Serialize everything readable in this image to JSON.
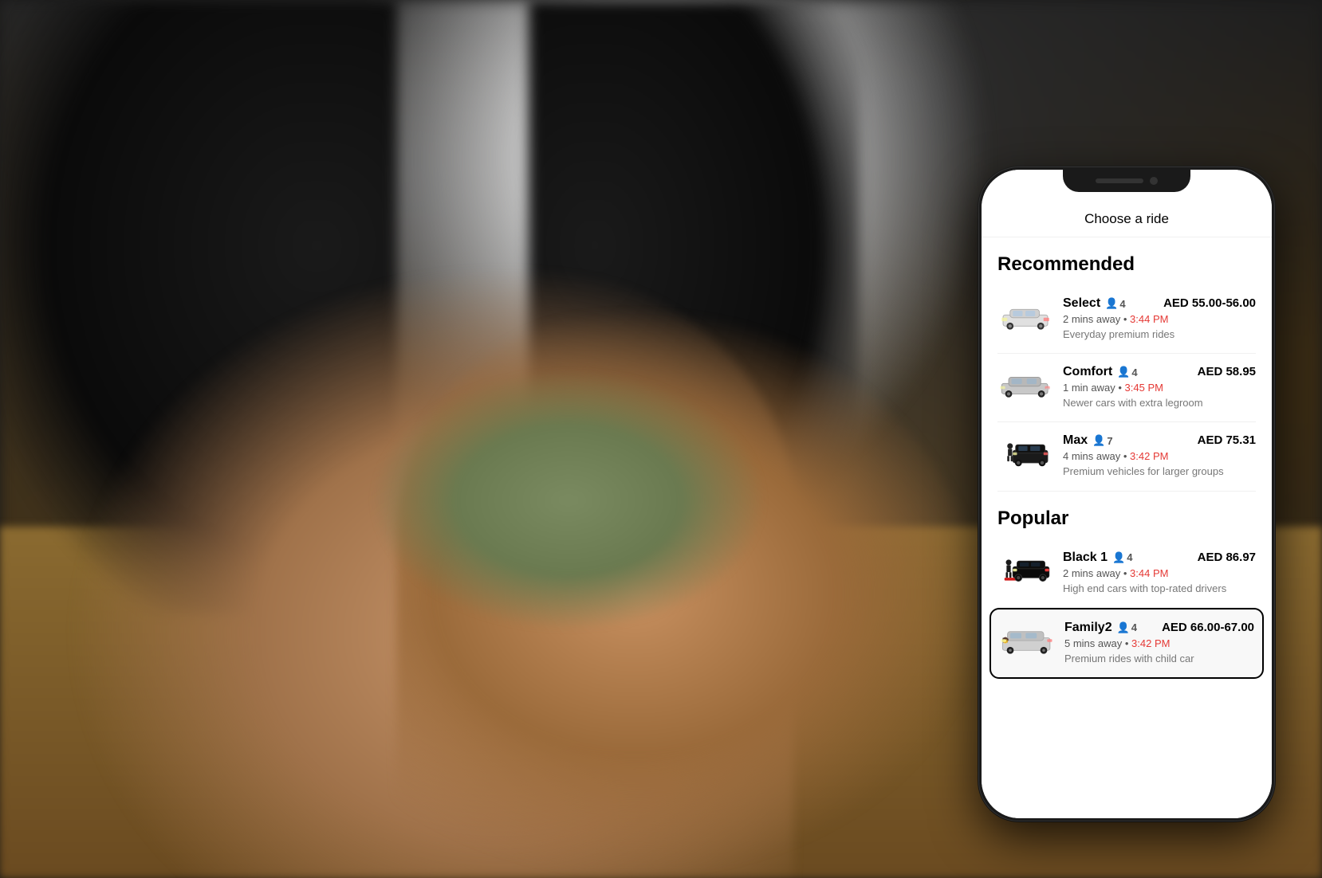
{
  "background": {
    "description": "Blurred photo of person handing money across table"
  },
  "phone": {
    "header": {
      "title": "Choose a ride"
    },
    "sections": [
      {
        "id": "recommended",
        "title": "Recommended",
        "rides": [
          {
            "id": "select",
            "name": "Select",
            "capacity": 4,
            "price": "AED 55.00-56.00",
            "eta": "2 mins away",
            "arrival_time": "3:44 PM",
            "description": "Everyday premium rides",
            "car_type": "sedan_white",
            "selected": false
          },
          {
            "id": "comfort",
            "name": "Comfort",
            "capacity": 4,
            "price": "AED 58.95",
            "eta": "1 min away",
            "arrival_time": "3:45 PM",
            "description": "Newer cars with extra legroom",
            "car_type": "sedan_silver",
            "selected": false
          },
          {
            "id": "max",
            "name": "Max",
            "capacity": 7,
            "price": "AED 75.31",
            "eta": "4 mins away",
            "arrival_time": "3:42 PM",
            "description": "Premium vehicles for larger groups",
            "car_type": "suv_black",
            "selected": false
          }
        ]
      },
      {
        "id": "popular",
        "title": "Popular",
        "rides": [
          {
            "id": "black1",
            "name": "Black 1",
            "capacity": 4,
            "price": "AED 86.97",
            "eta": "2 mins away",
            "arrival_time": "3:44 PM",
            "description": "High end cars with top-rated drivers",
            "car_type": "black_luxury",
            "selected": false
          },
          {
            "id": "family2",
            "name": "Family2",
            "capacity": 4,
            "price": "AED 66.00-67.00",
            "eta": "5 mins away",
            "arrival_time": "3:42 PM",
            "description": "Premium rides with child car",
            "car_type": "suv_family",
            "selected": true
          }
        ]
      }
    ],
    "labels": {
      "person_icon": "👤",
      "eta_separator": "•"
    }
  }
}
